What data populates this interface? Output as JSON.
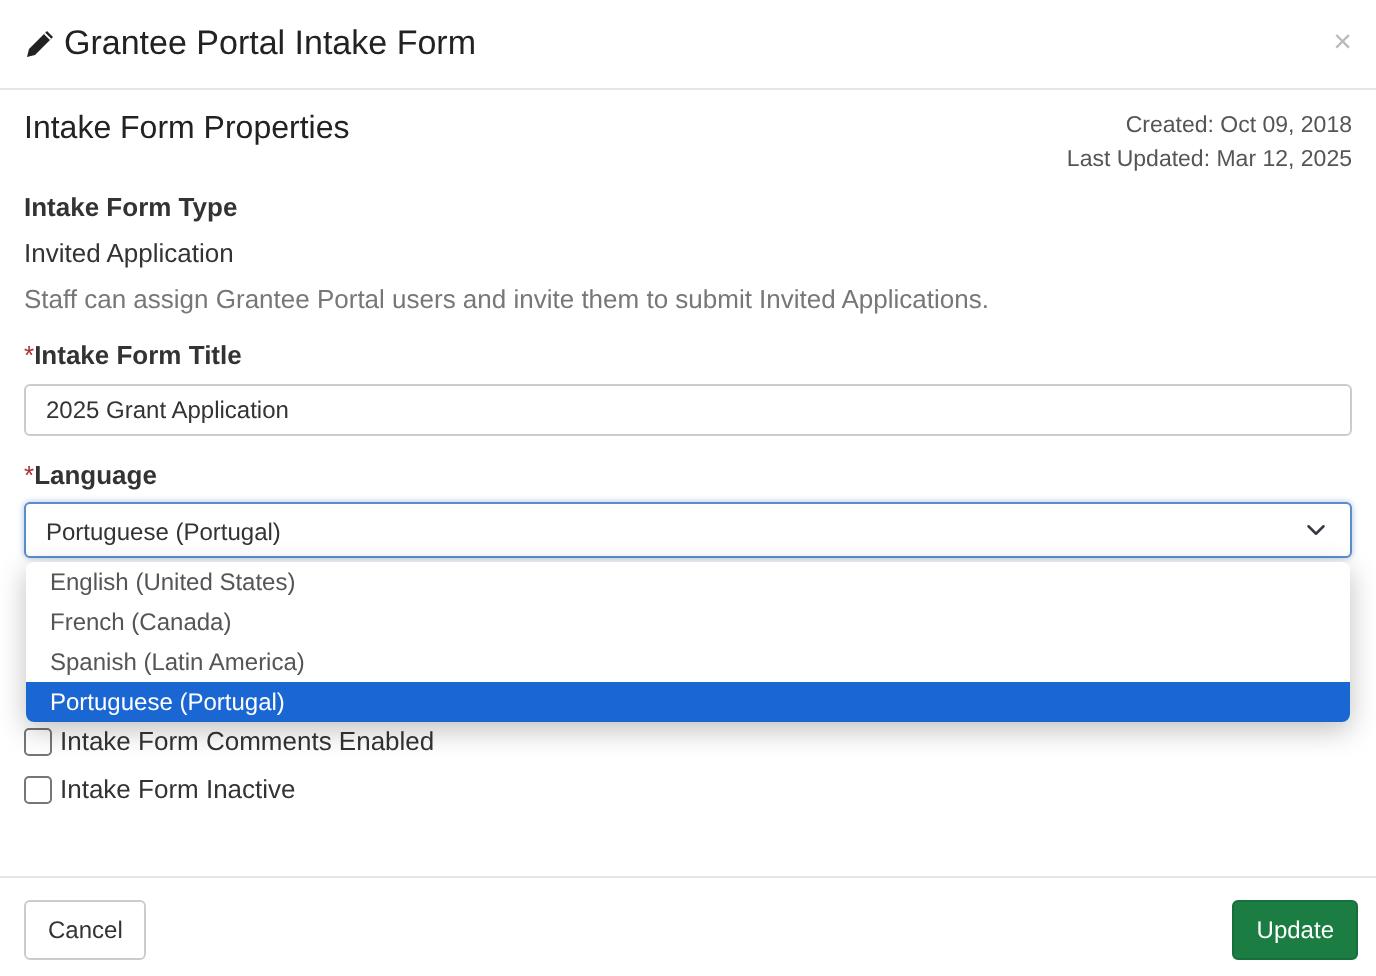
{
  "modal": {
    "title": "Grantee Portal Intake Form",
    "close": "×"
  },
  "properties": {
    "heading": "Intake Form Properties",
    "created": "Created: Oct 09, 2018",
    "updated": "Last Updated: Mar 12, 2025"
  },
  "form_type": {
    "label": "Intake Form Type",
    "value": "Invited Application",
    "help": "Staff can assign Grantee Portal users and invite them to submit Invited Applications."
  },
  "title_field": {
    "required_mark": "*",
    "label": "Intake Form Title",
    "value": "2025 Grant Application"
  },
  "language": {
    "required_mark": "*",
    "label": "Language",
    "value": "Portuguese (Portugal)",
    "expanded": true,
    "options": [
      {
        "label": "English (United States)",
        "selected": false
      },
      {
        "label": "French (Canada)",
        "selected": false
      },
      {
        "label": "Spanish (Latin America)",
        "selected": false
      },
      {
        "label": "Portuguese (Portugal)",
        "selected": true
      }
    ]
  },
  "checkboxes": [
    {
      "label": "Intake Form Comments Enabled",
      "checked": false
    },
    {
      "label": "Intake Form Inactive",
      "checked": false
    }
  ],
  "buttons": [
    {
      "label": "Cancel",
      "kind": "secondary"
    },
    {
      "label": "Update",
      "kind": "primary"
    }
  ]
}
